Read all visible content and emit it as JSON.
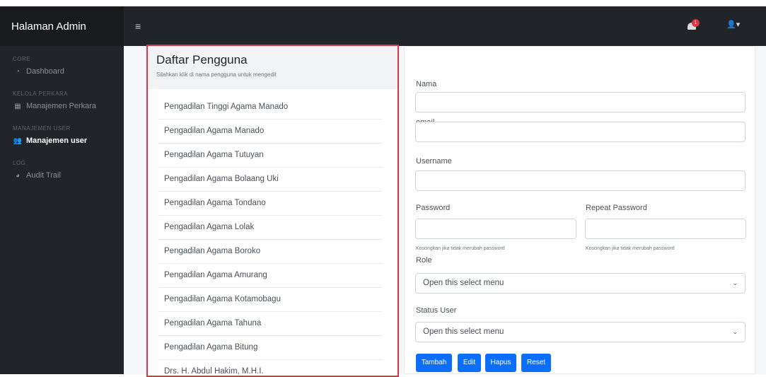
{
  "brand": "Halaman Admin",
  "sidebar": {
    "sections": [
      {
        "heading": "CORE",
        "items": [
          {
            "icon": "dashboard-icon",
            "label": "Dashboard",
            "active": false
          }
        ]
      },
      {
        "heading": "KELOLA PERKARA",
        "items": [
          {
            "icon": "table-icon",
            "label": "Manajemen Perkara",
            "active": false
          }
        ]
      },
      {
        "heading": "MANAJEMEN USER",
        "items": [
          {
            "icon": "users-icon",
            "label": "Manajemen user",
            "active": true
          }
        ]
      },
      {
        "heading": "LOG",
        "items": [
          {
            "icon": "chart-icon",
            "label": "Audit Trail",
            "active": false
          }
        ]
      }
    ]
  },
  "topbar": {
    "menu_icon": "hamburger-icon",
    "notification_icon": "bell-icon",
    "notification_count": "1",
    "user_icon": "user-icon"
  },
  "list": {
    "title": "Daftar Pengguna",
    "subtitle": "Silahkan klik di nama pengguna untuk mengedit",
    "items": [
      "Pengadilan Tinggi Agama Manado",
      "Pengadilan Agama Manado",
      "Pengadilan Agama Tutuyan",
      "Pengadilan Agama Bolaang Uki",
      "Pengadilan Agama Tondano",
      "Pengadilan Agama Lolak",
      "Pengadilan Agama Boroko",
      "Pengadilan Agama Amurang",
      "Pengadilan Agama Kotamobagu",
      "Pengadilan Agama Tahuna",
      "Pengadilan Agama Bitung",
      "Drs. H. Abdul Hakim, M.H.I."
    ]
  },
  "form": {
    "nama_label": "Nama",
    "nama_value": "",
    "email_label": "email",
    "email_value": "",
    "username_label": "Username",
    "username_value": "",
    "password_label": "Password",
    "repeat_password_label": "Repeat Password",
    "password_help": "Kosongkan jika tidak merubah password",
    "repeat_help": "Kosongkan jika tidak merubah password",
    "role_label": "Role",
    "role_selected": "Open this select menu",
    "status_label": "Status User",
    "status_selected": "Open this select menu",
    "buttons": {
      "tambah": "Tambah",
      "edit": "Edit",
      "hapus": "Hapus",
      "reset": "Reset"
    }
  },
  "colors": {
    "primary": "#0d6efd",
    "danger": "#dc3545",
    "sidebar": "#212529"
  }
}
